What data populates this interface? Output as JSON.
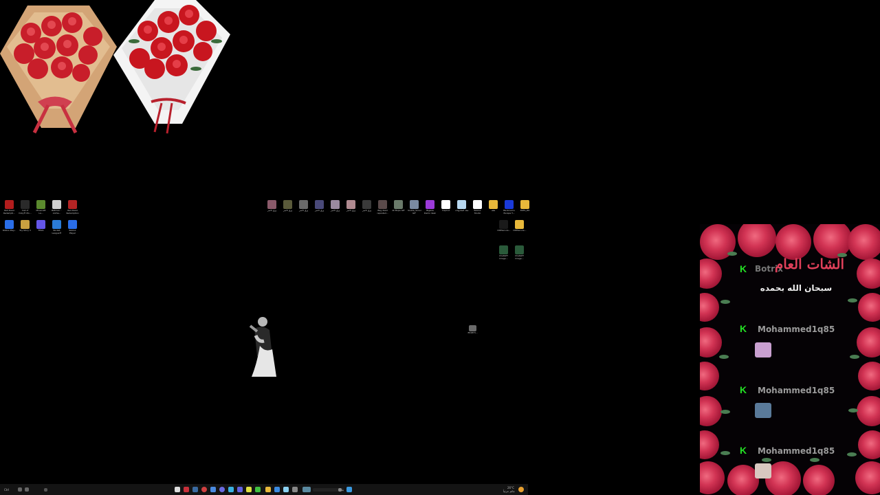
{
  "desktop_icons_left_row1": [
    {
      "label": "Red Dead Redempti...",
      "icon": "red-dead-icon",
      "color": "#b21d1d"
    },
    {
      "label": "Call of Duty® Mo...",
      "icon": "cod-icon",
      "color": "#2a2a2a"
    },
    {
      "label": "Minecraft La...",
      "icon": "minecraft-icon",
      "color": "#5b8a2e"
    },
    {
      "label": "Batman™ Arkha...",
      "icon": "batman-icon",
      "color": "#cfcfcf"
    },
    {
      "label": "Red Dead Redemption",
      "icon": "red-dead-2-icon",
      "color": "#b32424"
    }
  ],
  "desktop_icons_left_row2": [
    {
      "label": "Roblox Play...",
      "icon": "roblox-icon",
      "color": "#2a6ee8"
    },
    {
      "label": "Toy Story 3",
      "icon": "toy-story-icon",
      "color": "#c9a040"
    },
    {
      "label": "FPGS",
      "icon": "fpgs-icon",
      "color": "#6456e8"
    },
    {
      "label": "Rocket League®",
      "icon": "rocket-league-icon",
      "color": "#2b7bd6"
    },
    {
      "label": "Roblox Player",
      "icon": "roblox-player-icon",
      "color": "#2a6ee8"
    }
  ],
  "desktop_icons_mid_row": [
    {
      "label": "ورق الامير",
      "icon": "wallpaper-icon",
      "color": "#8a5a6a"
    },
    {
      "label": "ورق الامير",
      "icon": "wallpaper-icon",
      "color": "#5a5a3a"
    },
    {
      "label": "ورق الامير",
      "icon": "wallpaper-icon",
      "color": "#6a6a6a"
    },
    {
      "label": "ورق الامير",
      "icon": "wallpaper-icon",
      "color": "#4a4a7a"
    },
    {
      "label": "ورق الامير",
      "icon": "wallpaper-icon",
      "color": "#9a8aa0"
    },
    {
      "label": "ورق الامير",
      "icon": "wallpaper-icon",
      "color": "#b08a90"
    },
    {
      "label": "ورق الامير",
      "icon": "wallpaper-icon",
      "color": "#3a3a3a"
    },
    {
      "label": "Bag dead reposted...",
      "icon": "video-icon",
      "color": "#5a4a4a"
    },
    {
      "label": "Ali Bupe GIF",
      "icon": "gif-icon",
      "color": "#6a7a6a"
    },
    {
      "label": "double_Sonora GIF",
      "icon": "gif-icon",
      "color": "#7a8aa0"
    },
    {
      "label": "Bigsize Demo desk",
      "icon": "bigsize-icon",
      "color": "#9b3ad8"
    },
    {
      "label": "CapCut",
      "icon": "capcut-icon",
      "color": "#ffffff"
    },
    {
      "label": "سلة المحذوفات",
      "icon": "recycle-bin-icon",
      "color": "#b8d8f0"
    },
    {
      "label": "Roblox Studio",
      "icon": "roblox-studio-icon",
      "color": "#ffffff"
    },
    {
      "label": "ملف",
      "icon": "folder-icon",
      "color": "#e8b83a"
    },
    {
      "label": "Backrooms Escape T...",
      "icon": "backrooms-icon",
      "color": "#1a3ad8"
    },
    {
      "label": "DATA_RO",
      "icon": "folder-icon",
      "color": "#e8b83a"
    }
  ],
  "desktop_icons_right_col": [
    {
      "label": "CODSecure...",
      "icon": "cod-secure-icon",
      "color": "#1a1a1a"
    },
    {
      "label": "CODSecure...",
      "icon": "folder-icon",
      "color": "#e8b83a"
    }
  ],
  "desktop_icons_right_col2": [
    {
      "label": "ChatGPT Image...",
      "icon": "image-icon",
      "color": "#2a5a3a"
    },
    {
      "label": "ChatGPT Image...",
      "icon": "image-icon",
      "color": "#2a5a3a"
    }
  ],
  "desktop_icon_single": {
    "label": "ffmEfrfr...",
    "icon": "file-icon",
    "color": "#9a9a9a"
  },
  "chat": {
    "title": "الشات العام",
    "ghost_text": "Botrix",
    "subtitle": "سبحان الله بحمده",
    "badge": "K",
    "messages": [
      {
        "user": "Mohammed1q85",
        "emote": "emote-1",
        "emote_color": "#c9a0d0"
      },
      {
        "user": "Mohammed1q85",
        "emote": "emote-2",
        "emote_color": "#5a7a9a"
      },
      {
        "user": "Mohammed1q85",
        "emote": "emote-3",
        "emote_color": "#d8c8c0"
      }
    ]
  },
  "taskbar": {
    "left_text": "Ctrl",
    "weather": "26°C",
    "weather_desc": "غائم جزئياً",
    "search_placeholder": "بحث",
    "apps": [
      "start",
      "edge",
      "steam",
      "chrome",
      "discord",
      "files",
      "store",
      "photos",
      "settings",
      "vscode",
      "terminal"
    ]
  }
}
